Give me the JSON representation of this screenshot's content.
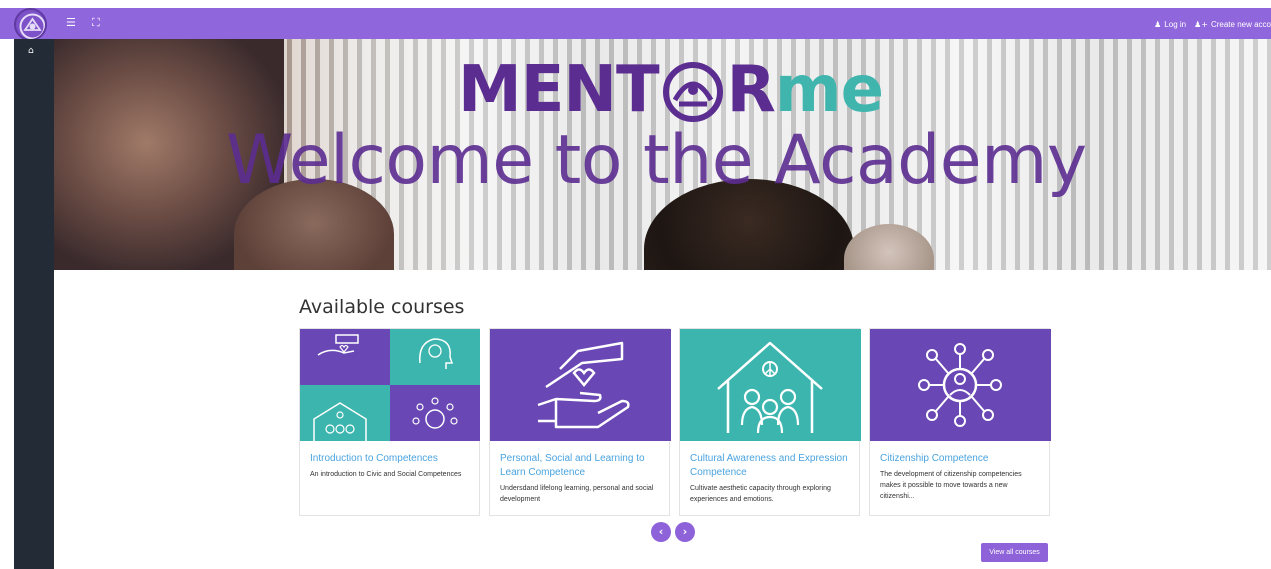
{
  "header": {
    "login_label": "Log in",
    "create_account_label": "Create new acco"
  },
  "hero": {
    "brand_part1": "MENT",
    "brand_part2": "R",
    "brand_part3": "me",
    "welcome_text": "Welcome to the Academy"
  },
  "courses": {
    "section_title": "Available courses",
    "items": [
      {
        "title": "Introduction to Competences",
        "description": "An introduction to Civic and Social Competences"
      },
      {
        "title": "Personal, Social and Learning to Learn Competence",
        "description": "Undersdand lifelong learning, personal and social development"
      },
      {
        "title": "Cultural Awareness and Expression Competence",
        "description": "Cultivate aesthetic capacity through exploring experiences and emotions."
      },
      {
        "title": "Citizenship Competence",
        "description": "The development of citizenship competencies makes it possible to move towards a new citizenshi..."
      }
    ],
    "prev_label": "‹",
    "next_label": "›",
    "view_all_label": "View all courses"
  },
  "icons": {
    "menu": "menu-icon",
    "fullscreen": "fullscreen-icon",
    "user": "user-icon",
    "add_user": "add-user-icon",
    "home": "home-icon"
  },
  "colors": {
    "topbar": "#9066dc",
    "sidebar": "#222b36",
    "brand_purple": "#5c2d91",
    "brand_teal": "#3fb5ad",
    "card_purple": "#6947b4",
    "card_teal": "#3bb5ad",
    "link_blue": "#4aa3df",
    "button_purple": "#8e62d8"
  }
}
